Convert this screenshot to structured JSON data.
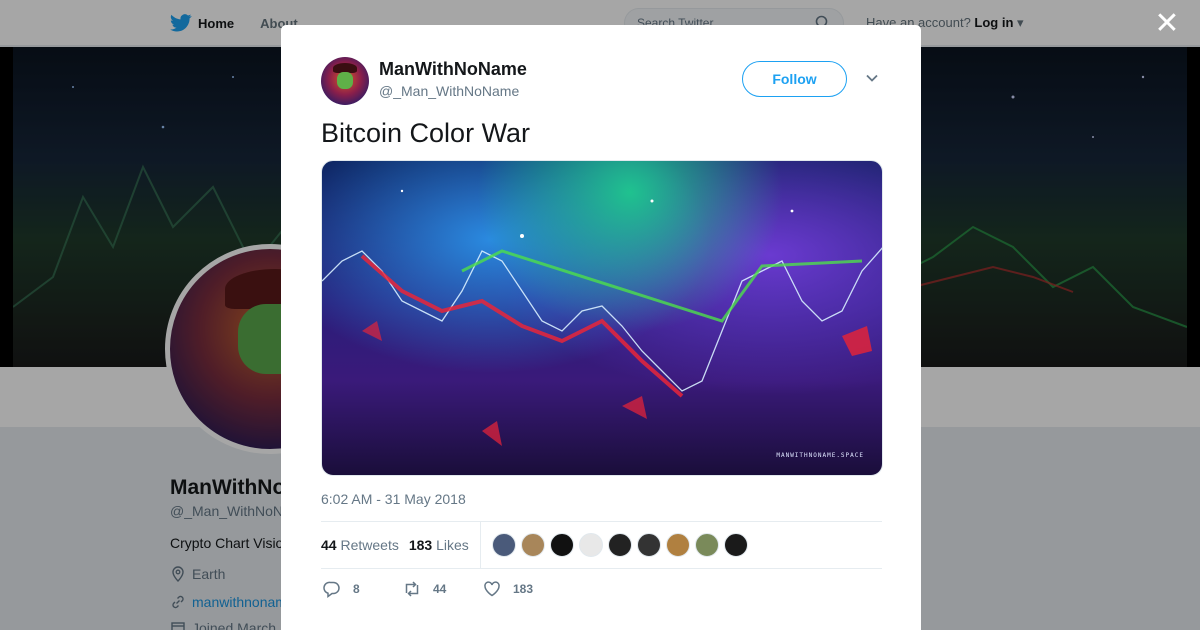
{
  "topbar": {
    "home_label": "Home",
    "about_label": "About",
    "search_placeholder": "Search Twitter",
    "account_prompt": "Have an account?",
    "login_label": "Log in"
  },
  "profile": {
    "name": "ManWithNoName",
    "handle": "@_Man_WithNoName",
    "bio": "Crypto Chart Visio",
    "location": "Earth",
    "website": "manwithnonam",
    "joined": "Joined March"
  },
  "tweet": {
    "author_name": "ManWithNoName",
    "author_handle": "@_Man_WithNoName",
    "follow_label": "Follow",
    "text": "Bitcoin Color War",
    "media_watermark": "MANWITHNONAME.SPACE",
    "timestamp": "6:02 AM - 31 May 2018",
    "retweets_count": "44",
    "retweets_label": "Retweets",
    "likes_count": "183",
    "likes_label": "Likes",
    "reply_count": "8",
    "retweet_action_count": "44",
    "like_action_count": "183",
    "liker_colors": [
      "#4a5a7a",
      "#a8865a",
      "#111111",
      "#e8e8e8",
      "#222222",
      "#333333",
      "#b08040",
      "#7a8a5a",
      "#1a1a1a"
    ]
  },
  "colors": {
    "accent": "#1da1f2",
    "link": "#1b95e0",
    "text_primary": "#14171a",
    "text_secondary": "#657786"
  },
  "icons": {
    "close": "close-icon",
    "bird": "twitter-bird-icon",
    "search": "search-icon",
    "chevron": "chevron-down-icon",
    "reply": "reply-icon",
    "retweet": "retweet-icon",
    "like": "heart-icon"
  }
}
